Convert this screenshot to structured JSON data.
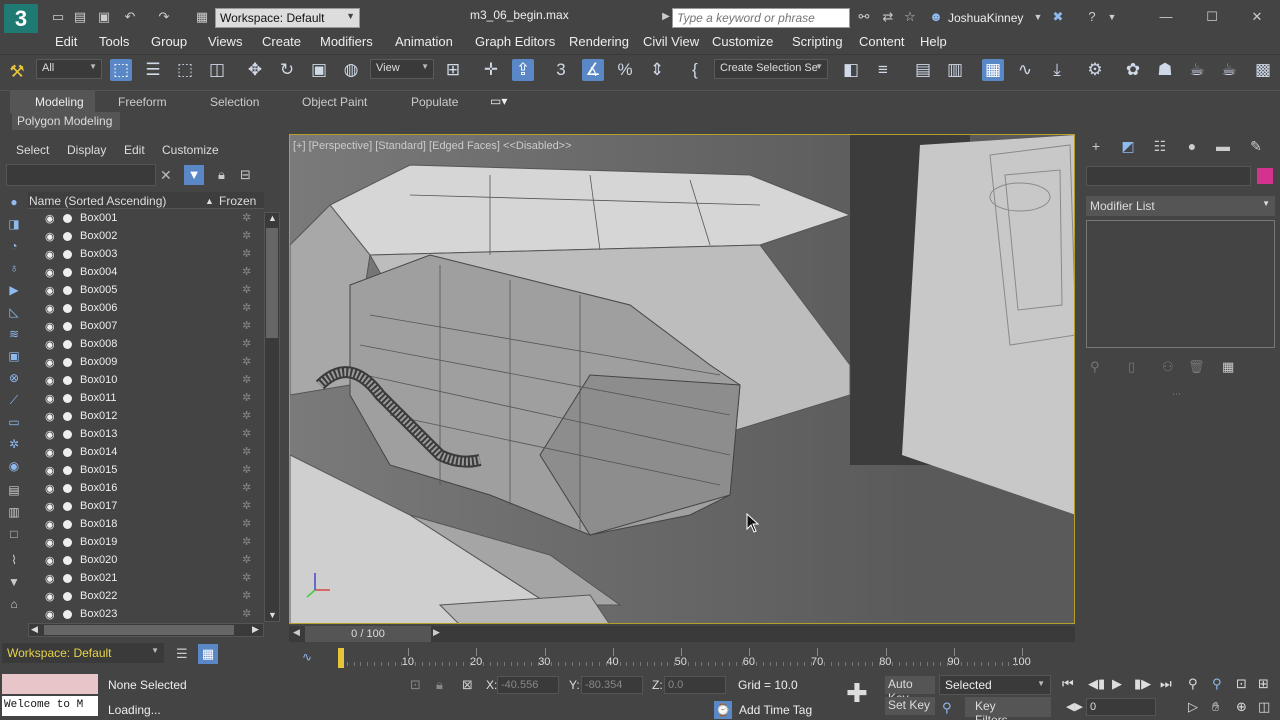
{
  "title_bar": {
    "logo": "3",
    "workspace": "Workspace: Default",
    "file_title": "m3_06_begin.max",
    "search_placeholder": "Type a keyword or phrase",
    "user": "JoshuaKinney"
  },
  "menu": [
    "Edit",
    "Tools",
    "Group",
    "Views",
    "Create",
    "Modifiers",
    "Animation",
    "Graph Editors",
    "Rendering",
    "Civil View",
    "Customize",
    "Scripting",
    "Content",
    "Help"
  ],
  "main_toolbar": {
    "selection_filter": "All",
    "reference_coord": "View",
    "selection_set": "Create Selection Se"
  },
  "ribbon": {
    "tabs": [
      "Modeling",
      "Freeform",
      "Selection",
      "Object Paint",
      "Populate"
    ],
    "active_tab": "Modeling",
    "panel": "Polygon Modeling"
  },
  "scene_explorer": {
    "menu": [
      "Select",
      "Display",
      "Edit",
      "Customize"
    ],
    "col_name": "Name (Sorted Ascending)",
    "sort_indicator": "▲",
    "col_frozen": "Frozen",
    "rows": [
      "Box001",
      "Box002",
      "Box003",
      "Box004",
      "Box005",
      "Box006",
      "Box007",
      "Box008",
      "Box009",
      "Box010",
      "Box011",
      "Box012",
      "Box013",
      "Box014",
      "Box015",
      "Box016",
      "Box017",
      "Box018",
      "Box019",
      "Box020",
      "Box021",
      "Box022",
      "Box023"
    ]
  },
  "viewport": {
    "label": "[+] [Perspective] [Standard] [Edged Faces] <<Disabled>>",
    "background": "#6a6a6a",
    "border_color": "#b79d2a"
  },
  "command_panel": {
    "modifier_list": "Modifier List",
    "object_color": "#d3338f"
  },
  "timeline": {
    "slider": "0 / 100",
    "ticks": [
      "10",
      "20",
      "30",
      "40",
      "50",
      "60",
      "70",
      "80",
      "90",
      "100"
    ]
  },
  "status_bar": {
    "workspace": "Workspace: Default",
    "welcome": "Welcome to M",
    "selection_status": "None Selected",
    "prompt": "Loading...",
    "x_label": "X:",
    "x_value": "-40.556",
    "y_label": "Y:",
    "y_value": "-80.354",
    "z_label": "Z:",
    "z_value": "0.0",
    "grid": "Grid = 10.0",
    "add_time_tag": "Add Time Tag",
    "auto_key": "Auto Key",
    "set_key": "Set Key",
    "key_mode": "Selected",
    "key_filters": "Key Filters...",
    "frame": "0"
  }
}
